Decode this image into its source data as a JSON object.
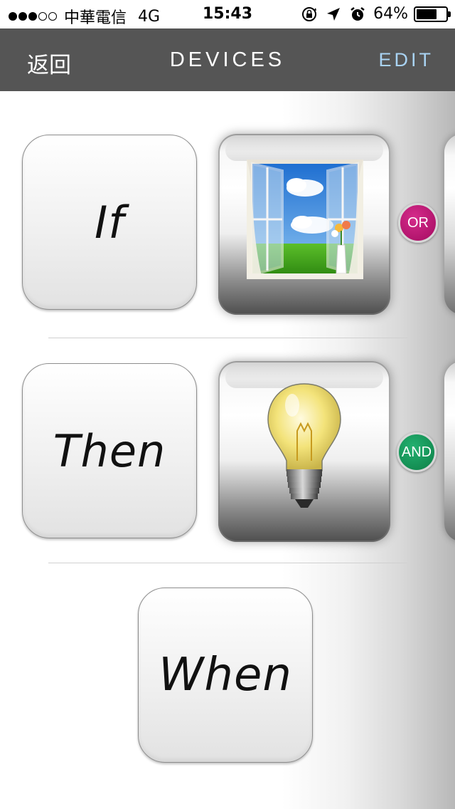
{
  "status_bar": {
    "carrier": "中華電信",
    "network": "4G",
    "time": "15:43",
    "battery_percent": "64%",
    "icons": [
      "rotation-lock-icon",
      "location-arrow-icon",
      "alarm-icon"
    ]
  },
  "nav": {
    "back_label": "返回",
    "title": "DEVICES",
    "edit_label": "EDIT"
  },
  "rules": {
    "if_label": "If",
    "then_label": "Then",
    "when_label": "When",
    "if_device": "window-icon",
    "then_device": "light-bulb-icon",
    "if_operator": "OR",
    "then_operator": "AND"
  },
  "colors": {
    "nav_background": "#555555",
    "edit_accent": "#a9d3f3",
    "or_badge": "#b5126e",
    "and_badge": "#12915a"
  }
}
